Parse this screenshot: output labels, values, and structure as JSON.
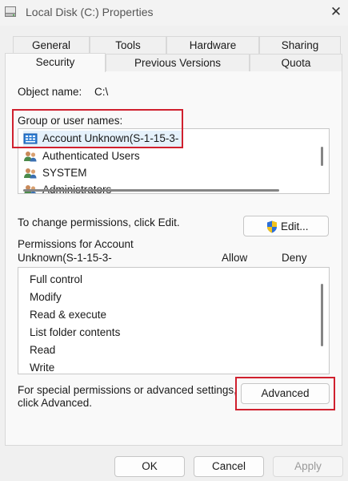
{
  "window": {
    "title": "Local Disk (C:) Properties",
    "close_glyph": "✕"
  },
  "tabs": {
    "row1": [
      "General",
      "Tools",
      "Hardware",
      "Sharing"
    ],
    "row2": [
      "Security",
      "Previous Versions",
      "Quota"
    ],
    "active": "Security"
  },
  "object": {
    "label": "Object name:",
    "value": "C:\\"
  },
  "group": {
    "label": "Group or user names:",
    "users": [
      {
        "name": "Account Unknown(S-1-15-3-",
        "icon": "unknown-account-icon"
      },
      {
        "name": "Authenticated Users",
        "icon": "users-group-icon"
      },
      {
        "name": "SYSTEM",
        "icon": "users-group-icon"
      },
      {
        "name": "Administrators",
        "icon": "users-group-icon"
      }
    ]
  },
  "edit": {
    "hint": "To change permissions, click Edit.",
    "button": "Edit..."
  },
  "permissions": {
    "header_line1": "Permissions for Account",
    "header_line2": "Unknown(S-1-15-3-",
    "allow": "Allow",
    "deny": "Deny",
    "items": [
      "Full control",
      "Modify",
      "Read & execute",
      "List folder contents",
      "Read",
      "Write"
    ]
  },
  "advanced": {
    "hint_line1": "For special permissions or advanced settings,",
    "hint_line2": "click Advanced.",
    "button": "Advanced"
  },
  "footer": {
    "ok": "OK",
    "cancel": "Cancel",
    "apply": "Apply"
  },
  "colors": {
    "highlight": "#d0202e",
    "selection": "#cce8ff",
    "shield_blue": "#2d6fd6",
    "shield_yellow": "#f2c21b"
  }
}
